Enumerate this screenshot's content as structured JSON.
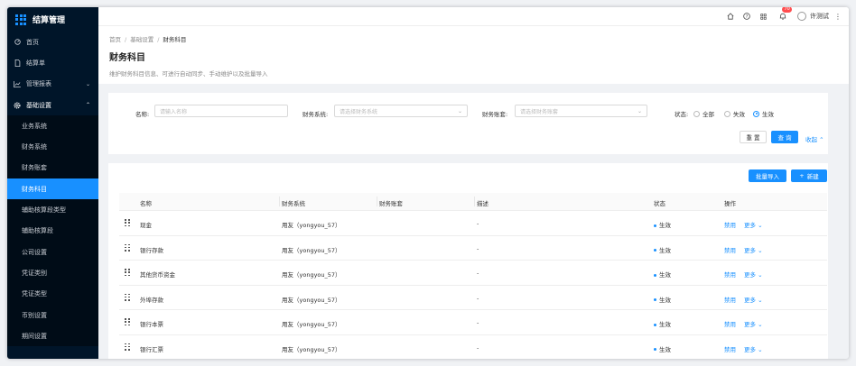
{
  "app": {
    "title": "结算管理"
  },
  "sidebar": {
    "items": [
      {
        "label": "首页",
        "icon": "dashboard-icon"
      },
      {
        "label": "结算单",
        "icon": "file-icon"
      },
      {
        "label": "管理报表",
        "icon": "chart-icon"
      },
      {
        "label": "基础设置",
        "icon": "gear-icon"
      }
    ],
    "sub_items": [
      {
        "label": "业务系统",
        "active": false
      },
      {
        "label": "财务系统",
        "active": false
      },
      {
        "label": "财务账套",
        "active": false
      },
      {
        "label": "财务科目",
        "active": true
      },
      {
        "label": "辅助核算段类型",
        "active": false
      },
      {
        "label": "辅助核算段",
        "active": false
      },
      {
        "label": "公司设置",
        "active": false
      },
      {
        "label": "凭证类别",
        "active": false
      },
      {
        "label": "凭证类型",
        "active": false
      },
      {
        "label": "币别设置",
        "active": false
      },
      {
        "label": "期间设置",
        "active": false
      }
    ]
  },
  "topbar": {
    "notification_count": "70",
    "user_name": "许测试"
  },
  "breadcrumb": {
    "home": "首页",
    "parent": "基础设置",
    "current": "财务科目"
  },
  "page": {
    "title": "财务科目",
    "description": "维护财务科目信息、可进行自动同步、手动维护以及批量导入"
  },
  "filter": {
    "name_label": "名称:",
    "name_placeholder": "请输入名称",
    "system_label": "财务系统:",
    "system_placeholder": "请选择财务系统",
    "book_label": "财务账套:",
    "book_placeholder": "请选择财务账套",
    "status_label": "状态:",
    "status_options": [
      "全部",
      "失效",
      "生效"
    ],
    "status_selected": "生效",
    "reset_label": "重 置",
    "query_label": "查 询",
    "collapse_label": "收起"
  },
  "toolbar": {
    "import_label": "批量导入",
    "new_label": "新建"
  },
  "table": {
    "columns": [
      "名称",
      "财务系统",
      "财务账套",
      "描述",
      "状态",
      "操作"
    ],
    "rows": [
      {
        "name": "现金",
        "system": "用友（yongyou_57）",
        "book": "",
        "desc": "-",
        "status": "生效",
        "op1": "禁用",
        "op2": "更多"
      },
      {
        "name": "银行存款",
        "system": "用友（yongyou_57）",
        "book": "",
        "desc": "-",
        "status": "生效",
        "op1": "禁用",
        "op2": "更多"
      },
      {
        "name": "其他货币资金",
        "system": "用友（yongyou_57）",
        "book": "",
        "desc": "-",
        "status": "生效",
        "op1": "禁用",
        "op2": "更多"
      },
      {
        "name": "外埠存款",
        "system": "用友（yongyou_57）",
        "book": "",
        "desc": "-",
        "status": "生效",
        "op1": "禁用",
        "op2": "更多"
      },
      {
        "name": "银行本票",
        "system": "用友（yongyou_57）",
        "book": "",
        "desc": "-",
        "status": "生效",
        "op1": "禁用",
        "op2": "更多"
      },
      {
        "name": "银行汇票",
        "system": "用友（yongyou_57）",
        "book": "",
        "desc": "-",
        "status": "生效",
        "op1": "禁用",
        "op2": "更多"
      }
    ]
  },
  "colors": {
    "primary": "#1890ff",
    "sidebar_bg": "#001529"
  }
}
